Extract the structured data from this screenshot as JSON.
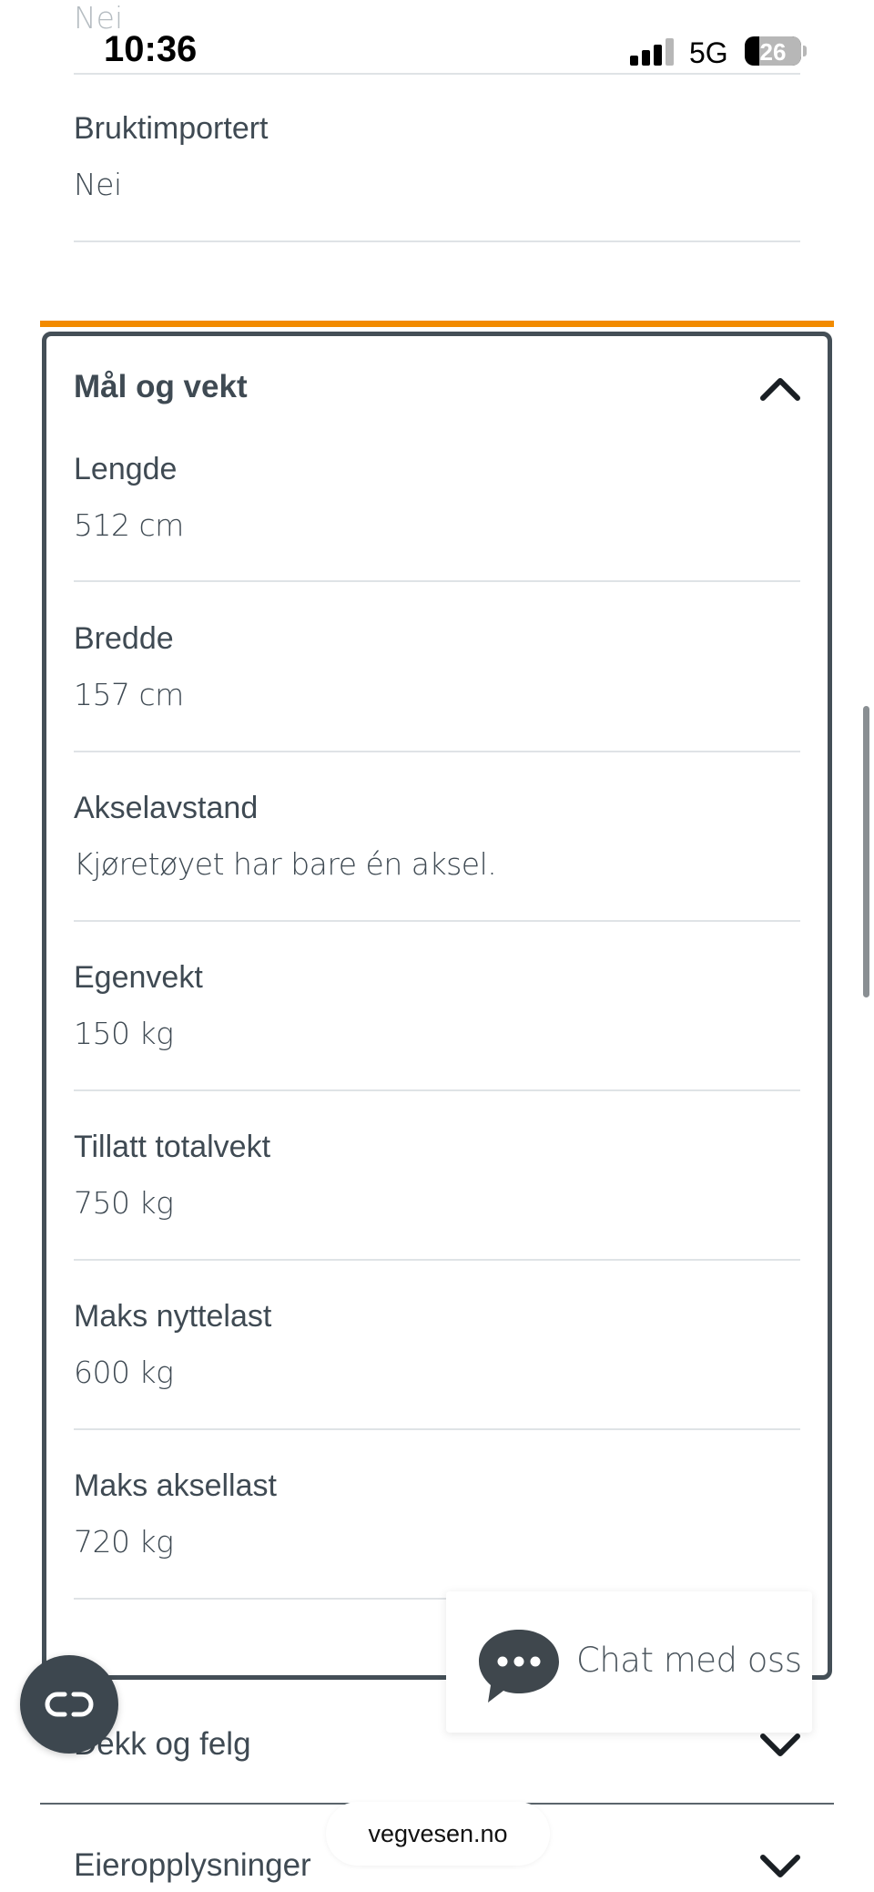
{
  "status_bar": {
    "time": "10:36",
    "network": "5G",
    "battery_level": "26"
  },
  "previous_value": "Nei",
  "top_rows": [
    {
      "label": "Bruktimportert",
      "value": "Nei"
    }
  ],
  "panel": {
    "title": "Mål og vekt",
    "expanded": true,
    "accent_color": "#f28b00",
    "rows": [
      {
        "label": "Lengde",
        "value": "512 cm"
      },
      {
        "label": "Bredde",
        "value": "157 cm"
      },
      {
        "label": "Akselavstand",
        "value": "Kjøretøyet har bare én aksel."
      },
      {
        "label": "Egenvekt",
        "value": "150 kg"
      },
      {
        "label": "Tillatt totalvekt",
        "value": "750 kg"
      },
      {
        "label": "Maks nyttelast",
        "value": "600 kg"
      },
      {
        "label": "Maks aksellast",
        "value": "720 kg"
      }
    ]
  },
  "collapsed_sections": [
    {
      "title": "Dekk og felg"
    },
    {
      "title": "Eieropplysninger"
    }
  ],
  "chat": {
    "label": "Chat med oss"
  },
  "browser": {
    "url": "vegvesen.no"
  },
  "icons": {
    "panel_toggle": "chevron-up-icon",
    "section_toggle": "chevron-down-icon",
    "chat": "chat-bubble-icon",
    "fab": "reader-mode-icon"
  }
}
